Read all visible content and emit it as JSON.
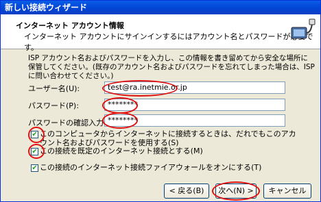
{
  "window": {
    "title": "新しい接続ウィザード"
  },
  "header": {
    "title": "インターネット アカウント情報",
    "subtitle": "インターネット アカウントにサインインするにはアカウント名とパスワードが必要です。"
  },
  "description": "ISP アカウント名およびパスワードを入力し、この情報を書き留めてから安全な場所に保管してください。(既存のアカウント名およびパスワードを忘れてしまった場合は、ISP に問い合わせてください。)",
  "fields": {
    "username": {
      "label": "ユーザー名(U):",
      "value": "test@ra.inetmie.or.jp"
    },
    "password": {
      "label": "パスワード(P):",
      "value": "********"
    },
    "confirm": {
      "label": "パスワードの確認入力(C):",
      "value": "********"
    }
  },
  "options": {
    "use_for_all": {
      "label": "このコンピュータからインターネットに接続するときは、だれでもこのアカウント名およびパスワードを使用する(S)",
      "checked": true
    },
    "default_connection": {
      "label": "この接続を既定のインターネット接続とする(M)",
      "checked": true
    },
    "firewall": {
      "label": "この接続のインターネット接続ファイアウォールをオンにする(T)",
      "checked": true
    }
  },
  "buttons": {
    "back": "< 戻る(B)",
    "next": "次へ(N) >",
    "cancel": "キャンセル"
  },
  "colors": {
    "highlight": "#e01010",
    "titlebar": "#0346d6",
    "checkmark": "#21a121"
  }
}
